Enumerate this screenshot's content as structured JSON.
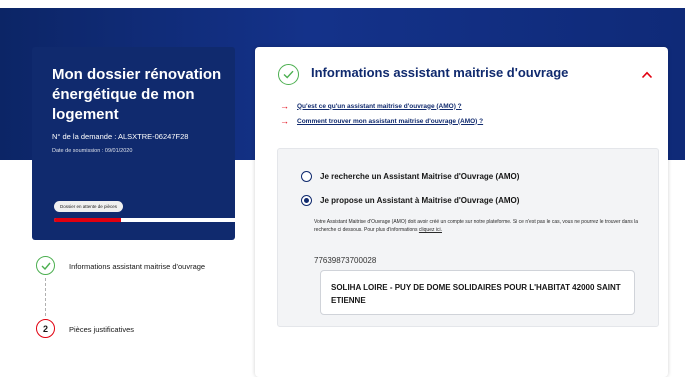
{
  "dossier": {
    "title": "Mon dossier rénovation énergétique de mon logement",
    "number": "N° de la demande : ALSXTRE-06247F28",
    "date": "Date de soumission : 09/01/2020",
    "status": "Dossier en attente de pièces",
    "progress": 0.35
  },
  "steps": [
    {
      "label": "Informations assistant maitrise d'ouvrage",
      "state": "done",
      "icon": "check-icon"
    },
    {
      "number": "2",
      "label": "Pièces justificatives",
      "state": "current"
    }
  ],
  "panel": {
    "title": "Informations assistant maitrise d'ouvrage",
    "links": [
      "Qu'est ce qu'un assistant maitrise d'ouvrage (AMO) ?",
      "Comment trouver mon assistant maitrise d'ouvrage (AMO) ?"
    ],
    "options": [
      {
        "label": "Je recherche un Assistant Maitrise d'Ouvrage (AMO)",
        "checked": false
      },
      {
        "label": "Je propose un Assistant à Maitrise d'Ouvrage (AMO)",
        "checked": true
      }
    ],
    "info_text": "Votre Assistant Maitrise d'Ouvrage (AMO) doit avoir créé un compte sur notre plateforme. Si ce n'est pas le cas, vous ne pourrez le trouver dans la recherche ci dessous. Pour plus d'informations",
    "info_link": "cliquez ici.",
    "siret": "77639873700028",
    "amo_result": "SOLIHA LOIRE - PUY DE DOME SOLIDAIRES POUR L'HABITAT 42000 SAINT ETIENNE"
  },
  "colors": {
    "navy": "#102a6e",
    "accent_red": "#e1000f",
    "success_green": "#4caf50"
  }
}
